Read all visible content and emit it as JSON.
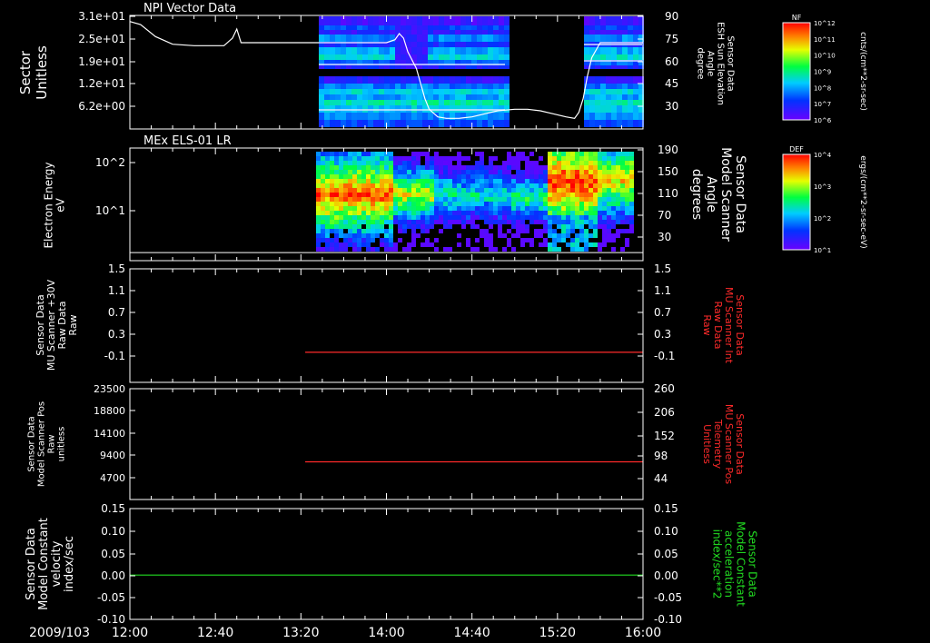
{
  "chart_data": [
    {
      "type": "heatmap",
      "title": "NPI Vector Data",
      "ylabel_lines": [
        "Sector",
        "Unitless"
      ],
      "yticks": [
        "3.1e+01",
        "2.5e+01",
        "1.9e+01",
        "1.2e+01",
        "6.2e+00"
      ],
      "right_label_lines": [
        "Sensor Data",
        "ESH Sun Elevation",
        "Angle",
        "degree"
      ],
      "right_ticks": [
        "90",
        "75",
        "60",
        "45",
        "30"
      ],
      "right_ylim": [
        15,
        90
      ],
      "line_series": {
        "name": "ESH Sun Elevation Angle",
        "x": [
          "12:00",
          "12:05",
          "12:12",
          "12:20",
          "12:30",
          "12:40",
          "12:44",
          "12:48",
          "12:50",
          "12:52",
          "13:00",
          "13:20",
          "13:40",
          "14:00",
          "14:04",
          "14:06",
          "14:08",
          "14:10",
          "14:14",
          "14:16",
          "14:18",
          "14:20",
          "14:24",
          "14:28",
          "14:34",
          "14:40",
          "14:46",
          "14:52",
          "15:00",
          "15:06",
          "15:12",
          "15:18",
          "15:24",
          "15:28",
          "15:30",
          "15:32",
          "15:34",
          "15:36",
          "15:40",
          "15:50",
          "16:00"
        ],
        "values": [
          86,
          84,
          76,
          71,
          70,
          70,
          70,
          75,
          81,
          72,
          72,
          72,
          72,
          72,
          74,
          78,
          75,
          66,
          55,
          45,
          35,
          28,
          23,
          22,
          22,
          23,
          25,
          27,
          28,
          28,
          27,
          25,
          23,
          22,
          26,
          35,
          50,
          62,
          72,
          72,
          72
        ]
      },
      "colorbar": {
        "label": "NF",
        "units": "cnts/(cm**2-sr-sec)",
        "ticks": [
          "10^12",
          "10^11",
          "10^10",
          "10^9",
          "10^8",
          "10^7",
          "10^6"
        ]
      }
    },
    {
      "type": "heatmap",
      "title": "MEx ELS-01 LR",
      "ylabel_lines": [
        "Electron Energy",
        "eV"
      ],
      "yticks": [
        "10^2",
        "10^1"
      ],
      "right_label_lines": [
        "Sensor Data",
        "Model Scanner",
        "Angle",
        "degrees"
      ],
      "right_ticks": [
        "190",
        "150",
        "110",
        "70",
        "30"
      ],
      "right_ylim": [
        0,
        190
      ],
      "line_series": {
        "name": "Model Scanner Angle",
        "x": [
          "12:00",
          "16:00"
        ],
        "values": [
          9,
          9
        ]
      },
      "colorbar": {
        "label": "DEF",
        "units": "ergs/(cm**2-sr-sec-eV)",
        "ticks": [
          "10^4",
          "10^3",
          "10^2",
          "10^1"
        ]
      }
    },
    {
      "type": "line",
      "ylabel_lines": [
        "Sensor Data",
        "MU Scanner +30V",
        "Raw Data",
        "Raw"
      ],
      "yticks": [
        "1.5",
        "1.1",
        "0.7",
        "0.3",
        "-0.1"
      ],
      "ylim": [
        -0.5,
        1.5
      ],
      "right_label_lines": [
        "Sensor Data",
        "MU Scanner Int",
        "Raw Data",
        "Raw"
      ],
      "right_ticks": [
        "1.5",
        "1.1",
        "0.7",
        "0.3",
        "-0.1"
      ],
      "series": [
        {
          "x": [
            "13:22",
            "16:00"
          ],
          "values": [
            0.03,
            0.03
          ],
          "color": "#ff2a2a"
        }
      ]
    },
    {
      "type": "line",
      "ylabel_lines": [
        "Sensor Data",
        "Model Scanner Pos",
        "Raw",
        "unitless"
      ],
      "yticks": [
        "23500",
        "18800",
        "14100",
        "9400",
        "4700"
      ],
      "ylim": [
        0,
        23500
      ],
      "right_label_lines": [
        "Sensor Data",
        "MU Scanner Pos",
        "Telemetry",
        "Unitless"
      ],
      "right_ticks": [
        "260",
        "206",
        "152",
        "98",
        "44"
      ],
      "series": [
        {
          "x": [
            "13:22",
            "16:00"
          ],
          "values": [
            8000,
            8000
          ],
          "color": "#ff2a2a"
        }
      ]
    },
    {
      "type": "line",
      "ylabel_lines": [
        "Sensor Data",
        "Model Constant",
        "velocity",
        "index/sec"
      ],
      "yticks": [
        "0.15",
        "0.10",
        "0.05",
        "0.00",
        "-0.05",
        "-0.10"
      ],
      "ylim": [
        -0.1,
        0.15
      ],
      "right_label_lines": [
        "Sensor Data",
        "Model Constant",
        "acceleration",
        "index/sec**2"
      ],
      "right_ticks": [
        "0.15",
        "0.10",
        "0.05",
        "0.00",
        "-0.05",
        "-0.10"
      ],
      "series": [
        {
          "x": [
            "12:00",
            "16:00"
          ],
          "values": [
            0.0,
            0.0
          ],
          "color": "#22dd22"
        }
      ]
    }
  ],
  "time_axis": {
    "date": "2009/103",
    "ticks": [
      "12:00",
      "12:40",
      "13:20",
      "14:00",
      "14:40",
      "15:20",
      "16:00"
    ],
    "xlim": [
      "12:00",
      "16:00"
    ]
  },
  "colors": {
    "background": "#000000",
    "axes": "#ffffff",
    "red_label": "#ff2a2a",
    "green_label": "#22dd22"
  }
}
